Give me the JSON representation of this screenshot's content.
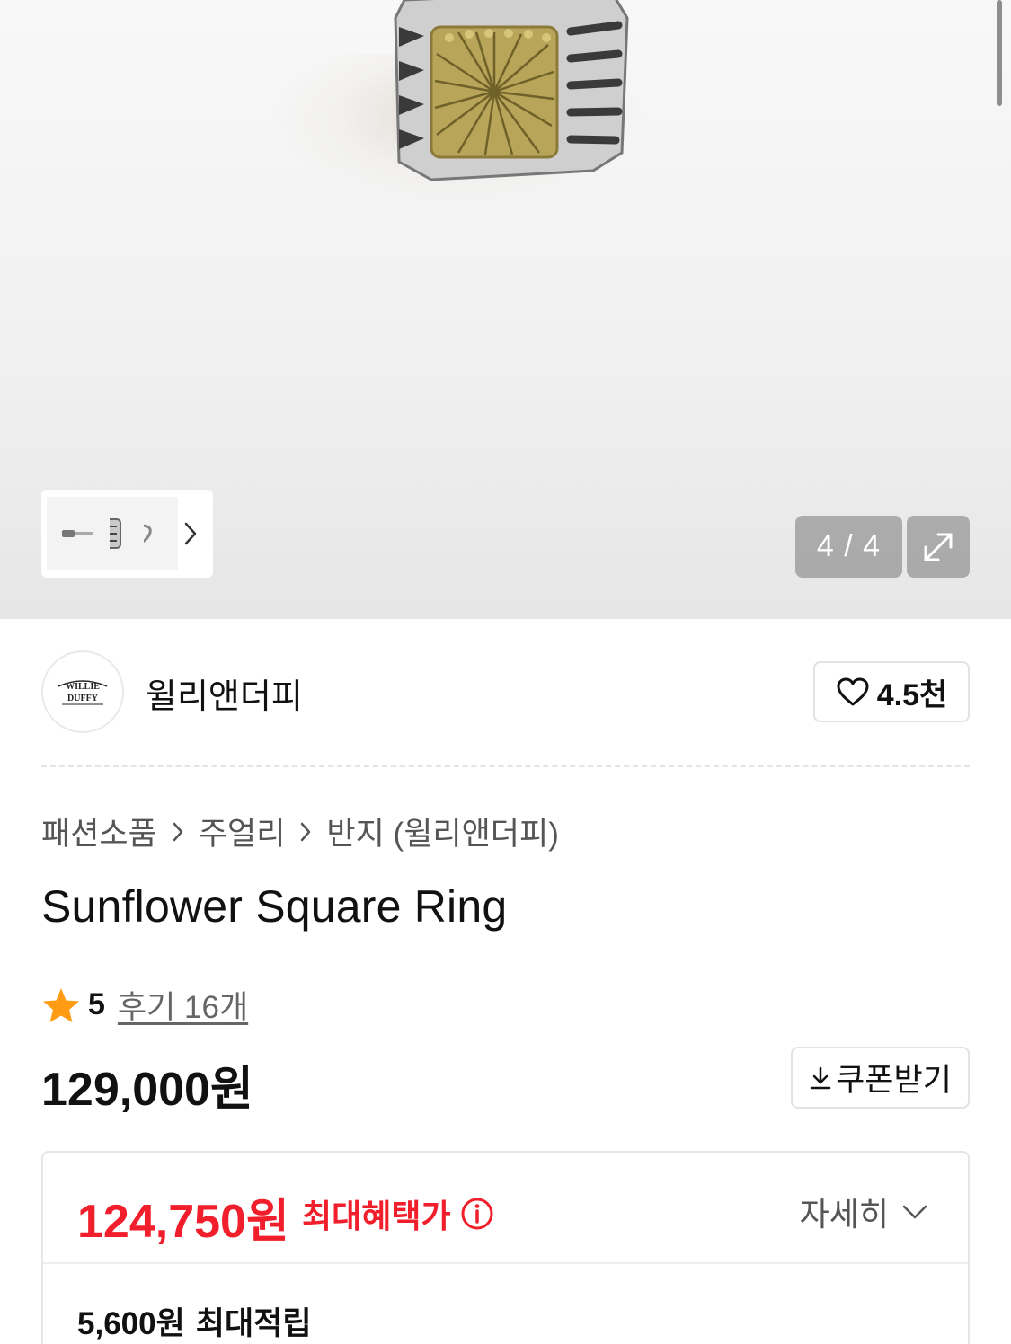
{
  "gallery": {
    "counter": "4 / 4",
    "icons": {
      "next": "chevron-right-icon",
      "expand": "expand-icon"
    }
  },
  "brand": {
    "name": "윌리앤더피",
    "logo_text": "WILLIE DUFFY",
    "likes": "4.5천",
    "like_icon": "heart-outline-icon"
  },
  "breadcrumb": [
    "패션소품",
    "주얼리",
    "반지 (윌리앤더피)"
  ],
  "product": {
    "title": "Sunflower Square Ring",
    "rating": "5",
    "review_link": "후기 16개",
    "price": "129,000원",
    "coupon_label": "쿠폰받기"
  },
  "benefit": {
    "price": "124,750원",
    "label": "최대혜택가",
    "detail_label": "자세히",
    "points_amount": "5,600원",
    "points_label": "최대적립"
  },
  "colors": {
    "accent_red": "#f01f2b",
    "star": "#ff9c13"
  }
}
